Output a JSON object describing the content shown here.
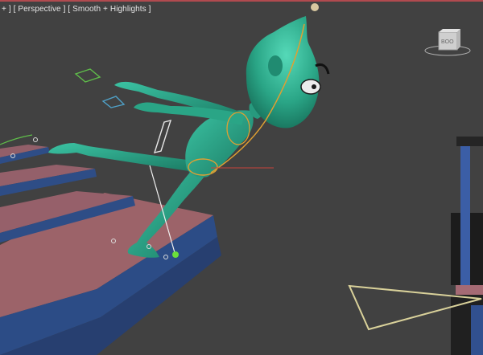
{
  "viewport": {
    "menu_plus": "+",
    "point_of_view": "[ Perspective ]",
    "shading_mode": "[ Smooth + Highlights ]",
    "bracket_open": "] "
  },
  "viewcube": {
    "face_label": "BOO"
  },
  "colors": {
    "background": "#414141",
    "character": "#2f9f86",
    "stair_top": "#9d6469",
    "stair_edge": "#2f4f87",
    "viewport_border": "#b14a4f",
    "pivot": "#6adf3a",
    "helper": "#d9d19a"
  },
  "icons": [
    "plus-menu-icon",
    "viewcube-icon",
    "ik-handle-icon",
    "pivot-gizmo-icon",
    "hand-controller-icon",
    "light-helper-icon"
  ]
}
